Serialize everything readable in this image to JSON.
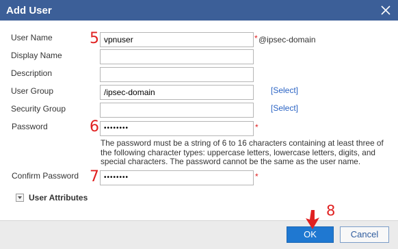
{
  "dialog": {
    "title": "Add User",
    "close_icon": "close-icon"
  },
  "form": {
    "user_name": {
      "label": "User Name",
      "value": "vpnuser",
      "required": "*",
      "suffix": "@ipsec-domain"
    },
    "display_name": {
      "label": "Display Name",
      "value": ""
    },
    "description": {
      "label": "Description",
      "value": ""
    },
    "user_group": {
      "label": "User Group",
      "value": "/ipsec-domain",
      "link": "[Select]"
    },
    "security_group": {
      "label": "Security Group",
      "value": "",
      "link": "[Select]"
    },
    "password": {
      "label": "Password",
      "value": "••••••••",
      "required": "*",
      "hint": "The password must be a string of 6 to 16 characters containing at least three of the following character types: uppercase letters, lowercase letters, digits, and special characters. The password cannot be the same as the user name."
    },
    "confirm_password": {
      "label": "Confirm Password",
      "value": "••••••••",
      "required": "*"
    },
    "user_attributes": {
      "label": "User Attributes",
      "icon": "caret-down-icon"
    }
  },
  "annotations": {
    "step_5": "5",
    "step_6": "6",
    "step_7": "7",
    "step_8": "8",
    "accent": "#e02020"
  },
  "footer": {
    "ok_label": "OK",
    "cancel_label": "Cancel"
  },
  "colors": {
    "titlebar": "#3c5f98",
    "primary_button": "#1f78d1",
    "link": "#2a63c4"
  }
}
